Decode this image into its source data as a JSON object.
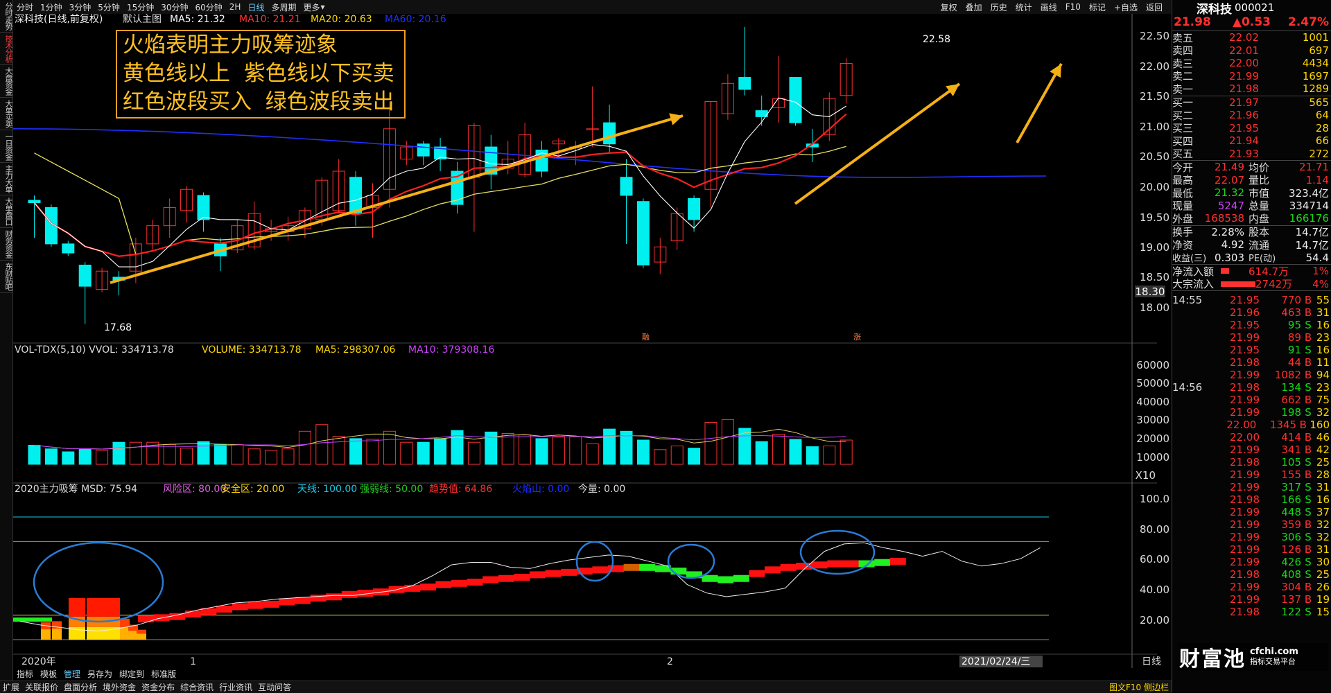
{
  "left_tabs": [
    "分时走势",
    "技术分析",
    "大盘资金",
    "大单买卖",
    "一日资金",
    "主力大单",
    "大单盘口",
    "财务资金",
    "东财贴吧"
  ],
  "left_active_index": 1,
  "toolbar": {
    "periods": [
      "分时",
      "1分钟",
      "3分钟",
      "5分钟",
      "15分钟",
      "30分钟",
      "60分钟",
      "2H",
      "日线",
      "多周期",
      "更多"
    ],
    "selected": "日线",
    "right_tools": [
      "复权",
      "叠加",
      "历史",
      "统计",
      "画线",
      "F10",
      "标记",
      "+自选",
      "返回"
    ]
  },
  "main_chart": {
    "title": "深科技",
    "mode": "(日线,前复权)",
    "layout": "默认主图",
    "ma5": "MA5: 21.32",
    "ma10": "MA10: 21.21",
    "ma20": "MA20: 20.63",
    "ma60": "MA60: 20.16",
    "y_ticks": [
      "22.50",
      "22.00",
      "21.50",
      "21.00",
      "20.50",
      "20.00",
      "19.50",
      "19.00",
      "18.50",
      "18.00"
    ],
    "price_marker": "18.30",
    "high_label": "22.58",
    "low_label": "17.68",
    "markers": [
      "融",
      "涨"
    ]
  },
  "annotation": {
    "line1": "火焰表明主力吸筹迹象",
    "line2": "黄色线以上  紫色线以下买卖",
    "line3": "红色波段买入  绿色波段卖出"
  },
  "volume_chart": {
    "title": "VOL-TDX(5,10)",
    "vvol": "VVOL: 334713.78",
    "volume": "VOLUME: 334713.78",
    "ma5": "MA5: 298307.06",
    "ma10": "MA10: 379308.16",
    "y_ticks": [
      "60000",
      "50000",
      "40000",
      "30000",
      "20000",
      "10000"
    ],
    "unit": "X10"
  },
  "indicator_chart": {
    "title": "2020主力吸筹",
    "msd": "MSD: 75.94",
    "risk": "风险区: 80.00",
    "safe": "安全区: 20.00",
    "sky": "天线: 100.00",
    "strongweak": "强弱线: 50.00",
    "trend": "趋势值: 64.86",
    "fire": "火焰山: 0.00",
    "today": "今量: 0.00",
    "y_ticks": [
      "100.0",
      "80.00",
      "60.00",
      "40.00",
      "20.00"
    ]
  },
  "x_axis": {
    "start": "2020年",
    "m1": "1",
    "m2": "2",
    "cursor_date": "2021/02/24/三",
    "period": "日线"
  },
  "menubar": [
    "指标",
    "模板",
    "管理",
    "另存为",
    "绑定到",
    "标准版"
  ],
  "bottombar": [
    "扩展",
    "关联报价",
    "盘面分析",
    "境外资金",
    "资金分布",
    "综合资讯",
    "行业资讯",
    "互动问答"
  ],
  "bottom_right": "图文F10 侧边栏",
  "quote": {
    "name": "深科技",
    "code": "000021",
    "price": "21.98",
    "change": "▲0.53",
    "pct": "2.47%",
    "asks": [
      {
        "label": "卖五",
        "price": "22.02",
        "vol": "1001"
      },
      {
        "label": "卖四",
        "price": "22.01",
        "vol": "697"
      },
      {
        "label": "卖三",
        "price": "22.00",
        "vol": "4434"
      },
      {
        "label": "卖二",
        "price": "21.99",
        "vol": "1697"
      },
      {
        "label": "卖一",
        "price": "21.98",
        "vol": "1289"
      }
    ],
    "bids": [
      {
        "label": "买一",
        "price": "21.97",
        "vol": "565"
      },
      {
        "label": "买二",
        "price": "21.96",
        "vol": "64"
      },
      {
        "label": "买三",
        "price": "21.95",
        "vol": "28"
      },
      {
        "label": "买四",
        "price": "21.94",
        "vol": "66"
      },
      {
        "label": "买五",
        "price": "21.93",
        "vol": "272"
      }
    ],
    "stats": [
      {
        "l1": "今开",
        "v1": "21.49",
        "l2": "均价",
        "v2": "21.71"
      },
      {
        "l1": "最高",
        "v1": "22.07",
        "l2": "量比",
        "v2": "1.14"
      },
      {
        "l1": "最低",
        "v1": "21.32",
        "l2": "市值",
        "v2": "323.4亿"
      },
      {
        "l1": "现量",
        "v1": "5247",
        "l2": "总量",
        "v2": "334714"
      },
      {
        "l1": "外盘",
        "v1": "168538",
        "l2": "内盘",
        "v2": "166176"
      }
    ],
    "stats2": [
      {
        "l1": "换手",
        "v1": "2.28%",
        "l2": "股本",
        "v2": "14.7亿"
      },
      {
        "l1": "净资",
        "v1": "4.92",
        "l2": "流通",
        "v2": "14.7亿"
      },
      {
        "l1": "收益(三)",
        "v1": "0.303",
        "l2": "PE(动)",
        "v2": "54.4"
      }
    ],
    "netflow": {
      "label": "净流入额",
      "value": "614.7万",
      "pct": "1%"
    },
    "blockflow": {
      "label": "大宗流入",
      "value": "2742万",
      "pct": "4%"
    }
  },
  "ticks": [
    {
      "t": "14:55",
      "p": "21.95",
      "v": "770",
      "bs": "B",
      "n": "55"
    },
    {
      "t": "",
      "p": "21.96",
      "v": "463",
      "bs": "B",
      "n": "31"
    },
    {
      "t": "",
      "p": "21.95",
      "v": "95",
      "bs": "S",
      "n": "16"
    },
    {
      "t": "",
      "p": "21.99",
      "v": "89",
      "bs": "B",
      "n": "23"
    },
    {
      "t": "",
      "p": "21.95",
      "v": "91",
      "bs": "S",
      "n": "16"
    },
    {
      "t": "",
      "p": "21.98",
      "v": "44",
      "bs": "B",
      "n": "11"
    },
    {
      "t": "",
      "p": "21.99",
      "v": "1082",
      "bs": "B",
      "n": "94"
    },
    {
      "t": "14:56",
      "p": "21.98",
      "v": "134",
      "bs": "S",
      "n": "23"
    },
    {
      "t": "",
      "p": "21.99",
      "v": "662",
      "bs": "B",
      "n": "75"
    },
    {
      "t": "",
      "p": "21.99",
      "v": "198",
      "bs": "S",
      "n": "32"
    },
    {
      "t": "",
      "p": "22.00",
      "v": "1345",
      "bs": "B",
      "n": "160"
    },
    {
      "t": "",
      "p": "22.00",
      "v": "414",
      "bs": "B",
      "n": "46"
    },
    {
      "t": "",
      "p": "21.99",
      "v": "341",
      "bs": "B",
      "n": "42"
    },
    {
      "t": "",
      "p": "21.98",
      "v": "105",
      "bs": "S",
      "n": "25"
    },
    {
      "t": "",
      "p": "21.99",
      "v": "155",
      "bs": "B",
      "n": "28"
    },
    {
      "t": "",
      "p": "21.99",
      "v": "317",
      "bs": "S",
      "n": "31"
    },
    {
      "t": "",
      "p": "21.98",
      "v": "166",
      "bs": "S",
      "n": "16"
    },
    {
      "t": "",
      "p": "21.99",
      "v": "448",
      "bs": "S",
      "n": "37"
    },
    {
      "t": "",
      "p": "21.99",
      "v": "359",
      "bs": "B",
      "n": "32"
    },
    {
      "t": "",
      "p": "21.99",
      "v": "306",
      "bs": "S",
      "n": "32"
    },
    {
      "t": "",
      "p": "21.99",
      "v": "126",
      "bs": "B",
      "n": "31"
    },
    {
      "t": "",
      "p": "21.99",
      "v": "426",
      "bs": "S",
      "n": "30"
    },
    {
      "t": "",
      "p": "21.98",
      "v": "408",
      "bs": "S",
      "n": "25"
    },
    {
      "t": "",
      "p": "21.99",
      "v": "304",
      "bs": "B",
      "n": "26"
    },
    {
      "t": "",
      "p": "21.99",
      "v": "137",
      "bs": "B",
      "n": "19"
    },
    {
      "t": "",
      "p": "21.98",
      "v": "122",
      "bs": "S",
      "n": "15"
    }
  ],
  "watermark": {
    "brand": "财富池",
    "site": "cfchi.com",
    "slogan": "指标交易平台"
  },
  "colors": {
    "up": "#ff3030",
    "down": "#00f0f0",
    "ma5": "#ffffff",
    "ma10": "#ff2020",
    "ma20": "#e8e060",
    "ma60": "#2030ff",
    "arrow": "#f5b016"
  }
}
